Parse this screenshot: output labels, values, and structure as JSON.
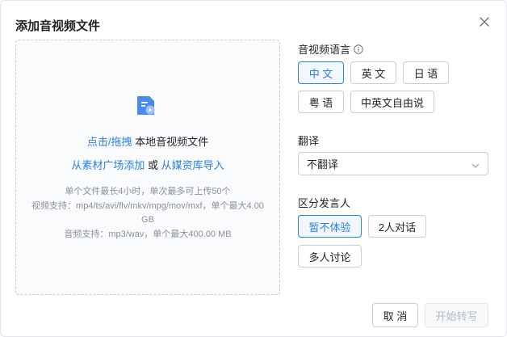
{
  "dialog": {
    "title": "添加音视频文件"
  },
  "dropzone": {
    "click_drag_link": "点击/拖拽",
    "local_file_text": " 本地音视频文件",
    "from_material_link": "从素材广场添加",
    "or_text": " 或 ",
    "from_media_link": "从媒资库导入",
    "note_line1": "单个文件最长4小时，单次最多可上传50个",
    "note_line2": "视频支持：mp4/ts/avi/flv/mkv/mpg/mov/mxf，单个最大4.00 GB",
    "note_line3": "音频支持：mp3/wav，单个最大400.00 MB"
  },
  "language": {
    "label": "音视频语言",
    "options": [
      "中 文",
      "英 文",
      "日 语",
      "粤 语",
      "中英文自由说"
    ],
    "selected": "中 文"
  },
  "translate": {
    "label": "翻译",
    "value": "不翻译"
  },
  "speaker": {
    "label": "区分发言人",
    "options": [
      "暂不体验",
      "2人对话",
      "多人讨论"
    ],
    "selected": "暂不体验"
  },
  "footer": {
    "cancel_label": "取 消",
    "start_label": "开始转写"
  },
  "colors": {
    "accent": "#2b7fe0",
    "border": "#c9cdd4",
    "muted_text": "#8a8f99"
  }
}
